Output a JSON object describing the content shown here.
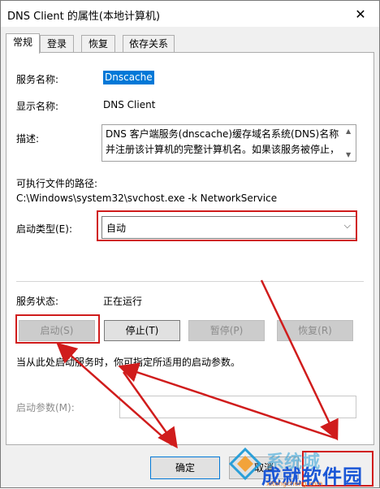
{
  "window": {
    "title": "DNS Client 的属性(本地计算机)",
    "close_glyph": "✕"
  },
  "tabs": [
    {
      "label": "常规"
    },
    {
      "label": "登录"
    },
    {
      "label": "恢复"
    },
    {
      "label": "依存关系"
    }
  ],
  "general": {
    "service_name_label": "服务名称:",
    "service_name_value": "Dnscache",
    "display_name_label": "显示名称:",
    "display_name_value": "DNS Client",
    "description_label": "描述:",
    "description_line1": "DNS 客户端服务(dnscache)缓存域名系统(DNS)名称",
    "description_line2": "并注册该计算机的完整计算机名。如果该服务被停止，",
    "exe_path_label": "可执行文件的路径:",
    "exe_path_value": "C:\\Windows\\system32\\svchost.exe -k NetworkService",
    "startup_type_label": "启动类型(E):",
    "startup_type_value": "自动",
    "service_status_label": "服务状态:",
    "service_status_value": "正在运行",
    "buttons": {
      "start": "启动(S)",
      "stop": "停止(T)",
      "pause": "暂停(P)",
      "resume": "恢复(R)"
    },
    "hint_text": "当从此处启动服务时，你可指定所适用的启动参数。",
    "start_params_label": "启动参数(M):",
    "start_params_value": ""
  },
  "dialog_buttons": {
    "ok": "确定",
    "cancel": "取消"
  },
  "watermark": {
    "text": "系统城",
    "sub": "xitongcheng.com",
    "overlay": "成就软件园"
  },
  "colors": {
    "annotation_red": "#d01c1c",
    "selection_blue": "#0078d7"
  },
  "icons": {
    "scroll_up": "scroll-up-icon",
    "scroll_down": "scroll-down-icon",
    "dropdown": "chevron-down-icon"
  }
}
